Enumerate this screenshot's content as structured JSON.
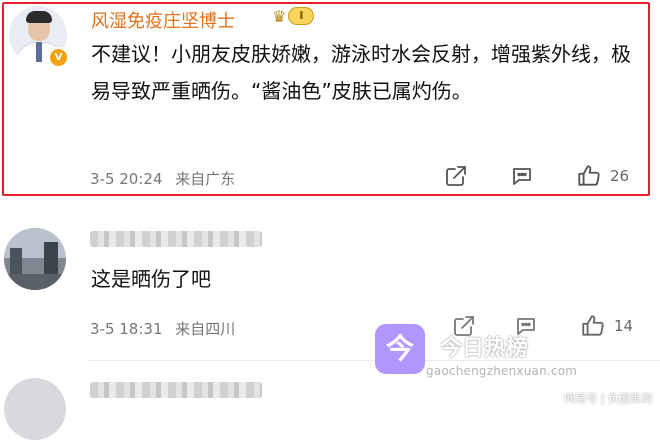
{
  "comments": [
    {
      "username": "风湿免疫庄坚博士",
      "verified_badge": "V",
      "level_badge": "I",
      "text": "不建议！小朋友皮肤娇嫩，游泳时水会反射，增强紫外线，极易导致严重晒伤。“酱油色”皮肤已属灼伤。",
      "date": "3-5 20:24",
      "location": "来自广东",
      "likes": "26",
      "highlighted": true,
      "highlight_color": "#e0202a",
      "username_color": "#e2721b"
    },
    {
      "username": "",
      "text": "这是晒伤了吧",
      "date": "3-5 18:31",
      "location": "来自四川",
      "likes": "14",
      "highlighted": false
    },
    {
      "username": "",
      "text": "",
      "highlighted": false
    }
  ],
  "icons": {
    "share": "share-icon",
    "reply": "comment-icon",
    "like": "thumbs-up-icon"
  },
  "watermark": {
    "logo_glyph": "今",
    "title": "今日热榜",
    "url": "gaochengzhenxuan.com",
    "corner": "网易号 | 负面黑洞",
    "logo_color": "#a98bff"
  }
}
